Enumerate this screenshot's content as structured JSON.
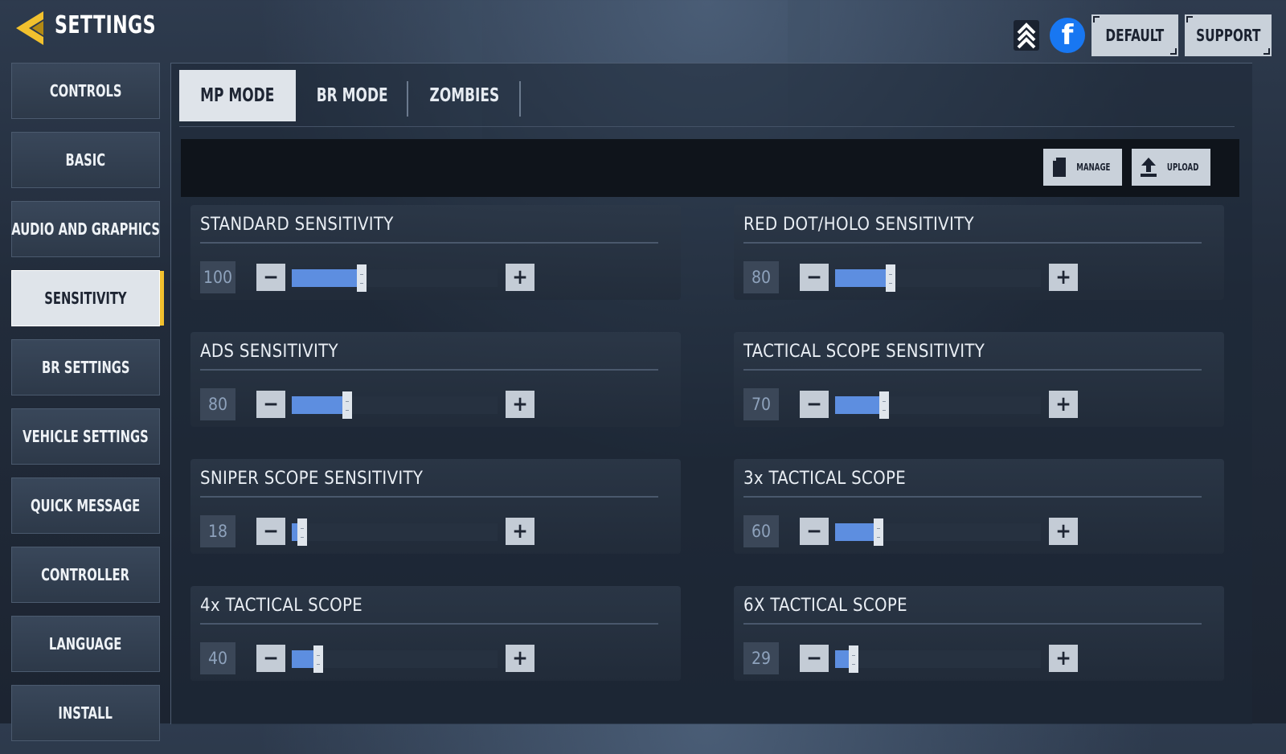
{
  "header": {
    "title": "SETTINGS",
    "default_label": "DEFAULT",
    "support_label": "SUPPORT",
    "facebook_glyph": "f",
    "accent_color": "#f2c12e"
  },
  "sidebar": {
    "items": [
      {
        "label": "CONTROLS"
      },
      {
        "label": "BASIC"
      },
      {
        "label": "AUDIO AND GRAPHICS"
      },
      {
        "label": "SENSITIVITY",
        "active": true
      },
      {
        "label": "BR SETTINGS"
      },
      {
        "label": "VEHICLE SETTINGS"
      },
      {
        "label": "QUICK MESSAGE"
      },
      {
        "label": "CONTROLLER"
      },
      {
        "label": "LANGUAGE"
      },
      {
        "label": "INSTALL"
      }
    ]
  },
  "tabs": [
    {
      "label": "MP MODE",
      "active": true
    },
    {
      "label": "BR MODE"
    },
    {
      "label": "ZOMBIES"
    }
  ],
  "toolbar": {
    "manage_label": "MANAGE",
    "upload_label": "UPLOAD"
  },
  "sensitivities": [
    {
      "label": "STANDARD SENSITIVITY",
      "value": "100",
      "fill_fraction": 0.34
    },
    {
      "label": "RED DOT/HOLO SENSITIVITY",
      "value": "80",
      "fill_fraction": 0.27
    },
    {
      "label": "ADS SENSITIVITY",
      "value": "80",
      "fill_fraction": 0.27
    },
    {
      "label": "TACTICAL SCOPE SENSITIVITY",
      "value": "70",
      "fill_fraction": 0.24
    },
    {
      "label": "SNIPER SCOPE SENSITIVITY",
      "value": "18",
      "fill_fraction": 0.05
    },
    {
      "label": "3x TACTICAL SCOPE",
      "value": "60",
      "fill_fraction": 0.21
    },
    {
      "label": "4x TACTICAL SCOPE",
      "value": "40",
      "fill_fraction": 0.13
    },
    {
      "label": "6X TACTICAL SCOPE",
      "value": "29",
      "fill_fraction": 0.09
    }
  ],
  "icons": {
    "back": "back-arrow-icon",
    "rank": "rank-chevron-icon",
    "facebook": "facebook-icon",
    "manage": "file-icon",
    "upload": "upload-icon"
  },
  "colors": {
    "slider_fill": "#5d8ee0",
    "active_bg": "#dfe4ea"
  }
}
